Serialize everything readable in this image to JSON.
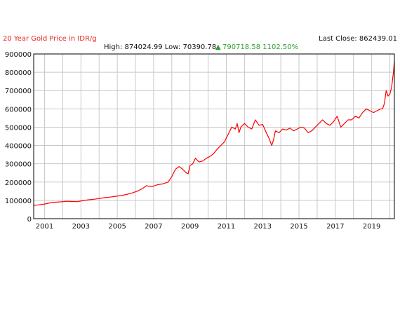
{
  "header": {
    "title": "20 Year Gold Price in IDR/g",
    "last_close_label": "Last Close: 862439.01",
    "high_low": "High: 874024.99 Low: 70390.78",
    "change": "790718.58 1102.50%"
  },
  "colors": {
    "title": "#e8281e",
    "line": "#ff0000",
    "change": "#2e9e2e",
    "grid": "#c8c8c8",
    "axis": "#000000"
  },
  "chart_data": {
    "type": "line",
    "title": "20 Year Gold Price in IDR/g",
    "xlabel": "",
    "ylabel": "",
    "xlim": [
      2000.4,
      2020.25
    ],
    "ylim": [
      0,
      900000
    ],
    "grid": true,
    "x_ticks": [
      "2001",
      "2003",
      "2005",
      "2007",
      "2009",
      "2011",
      "2013",
      "2015",
      "2017",
      "2019"
    ],
    "y_ticks": [
      "0",
      "100000",
      "200000",
      "300000",
      "400000",
      "500000",
      "600000",
      "700000",
      "800000",
      "900000"
    ],
    "series": [
      {
        "x": [
          2000.4,
          2000.7,
          2001.0,
          2001.3,
          2001.6,
          2001.9,
          2002.2,
          2002.5,
          2002.8,
          2003.1,
          2003.4,
          2003.7,
          2004.0,
          2004.3,
          2004.6,
          2004.9,
          2005.2,
          2005.5,
          2005.8,
          2006.1,
          2006.4,
          2006.6,
          2006.9,
          2007.2,
          2007.5,
          2007.8,
          2008.0,
          2008.2,
          2008.4,
          2008.6,
          2008.8,
          2008.9,
          2009.0,
          2009.15,
          2009.3,
          2009.5,
          2009.7,
          2009.9,
          2010.1,
          2010.3,
          2010.5,
          2010.7,
          2010.9,
          2011.1,
          2011.3,
          2011.5,
          2011.6,
          2011.7,
          2011.8,
          2012.0,
          2012.2,
          2012.4,
          2012.6,
          2012.8,
          2013.0,
          2013.2,
          2013.35,
          2013.5,
          2013.6,
          2013.7,
          2013.9,
          2014.1,
          2014.3,
          2014.5,
          2014.7,
          2014.9,
          2015.1,
          2015.3,
          2015.5,
          2015.7,
          2015.9,
          2016.1,
          2016.3,
          2016.5,
          2016.7,
          2016.9,
          2017.1,
          2017.3,
          2017.5,
          2017.7,
          2017.9,
          2018.1,
          2018.3,
          2018.5,
          2018.7,
          2018.9,
          2019.1,
          2019.3,
          2019.5,
          2019.6,
          2019.7,
          2019.8,
          2019.9,
          2020.0,
          2020.1,
          2020.2,
          2020.25
        ],
        "values": [
          72000,
          76000,
          80000,
          86000,
          90000,
          92000,
          95000,
          94000,
          93000,
          98000,
          103000,
          106000,
          110000,
          115000,
          118000,
          122000,
          126000,
          132000,
          140000,
          150000,
          165000,
          180000,
          175000,
          185000,
          190000,
          200000,
          230000,
          270000,
          285000,
          270000,
          250000,
          245000,
          290000,
          300000,
          330000,
          310000,
          315000,
          330000,
          340000,
          355000,
          380000,
          400000,
          420000,
          460000,
          500000,
          490000,
          520000,
          470000,
          500000,
          520000,
          500000,
          490000,
          540000,
          510000,
          515000,
          470000,
          440000,
          400000,
          430000,
          480000,
          470000,
          490000,
          485000,
          495000,
          480000,
          490000,
          500000,
          495000,
          470000,
          480000,
          500000,
          520000,
          540000,
          520000,
          510000,
          530000,
          560000,
          500000,
          520000,
          540000,
          540000,
          560000,
          550000,
          580000,
          600000,
          590000,
          580000,
          590000,
          600000,
          600000,
          630000,
          700000,
          670000,
          680000,
          720000,
          800000,
          862439
        ]
      }
    ]
  }
}
